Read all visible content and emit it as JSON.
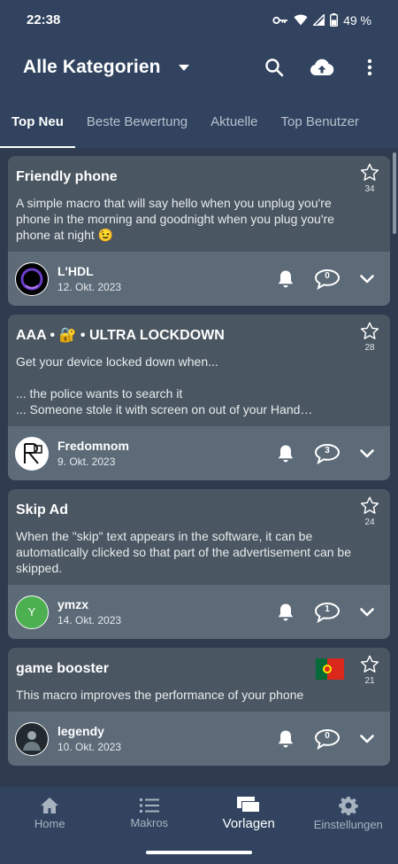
{
  "status_bar": {
    "time": "22:38",
    "battery": "49 %"
  },
  "app_bar": {
    "title": "Alle Kategorien",
    "icons": [
      "search-icon",
      "cloud-upload-icon",
      "more-vert-icon"
    ]
  },
  "tabs": [
    {
      "label": "Top Neu",
      "active": true
    },
    {
      "label": "Beste Bewertung",
      "active": false
    },
    {
      "label": "Aktuelle",
      "active": false
    },
    {
      "label": "Top Benutzer",
      "active": false
    }
  ],
  "cards": [
    {
      "title": "Friendly phone",
      "stars": "34",
      "description": "A simple macro that will say hello when you unplug you're phone in the morning and goodnight when you plug you're phone at night 😉",
      "user": "L'HDL",
      "date": "12. Okt. 2023",
      "comments": "0"
    },
    {
      "title": "AAA • 🔐 • ULTRA LOCKDOWN",
      "stars": "28",
      "description": "Get your device locked down when...\n\n... the police wants to search it\n... Someone stole it with screen on out of your Hand…",
      "user": "Fredomnom",
      "date": "9. Okt. 2023",
      "comments": "3"
    },
    {
      "title": "Skip Ad",
      "stars": "24",
      "description": "When the \"skip\" text appears in the software, it can be automatically clicked so that part of the advertisement can be skipped.",
      "user": "ymzx",
      "avatar_letter": "Y",
      "date": "14. Okt. 2023",
      "comments": "1"
    },
    {
      "title": "game booster",
      "stars": "21",
      "description": "This macro improves the performance of your phone",
      "user": "legendy",
      "date": "10. Okt. 2023",
      "comments": "0"
    }
  ],
  "bottom_nav": [
    {
      "label": "Home",
      "icon": "home-icon",
      "active": false
    },
    {
      "label": "Makros",
      "icon": "list-icon",
      "active": false
    },
    {
      "label": "Vorlagen",
      "icon": "templates-icon",
      "active": true
    },
    {
      "label": "Einstellungen",
      "icon": "gear-icon",
      "active": false
    }
  ],
  "colors": {
    "background": "#2f3c4f",
    "bar": "#31435f",
    "card": "#4a5661",
    "card_footer": "#5d6b78",
    "avatar_green": "#4caf50"
  }
}
